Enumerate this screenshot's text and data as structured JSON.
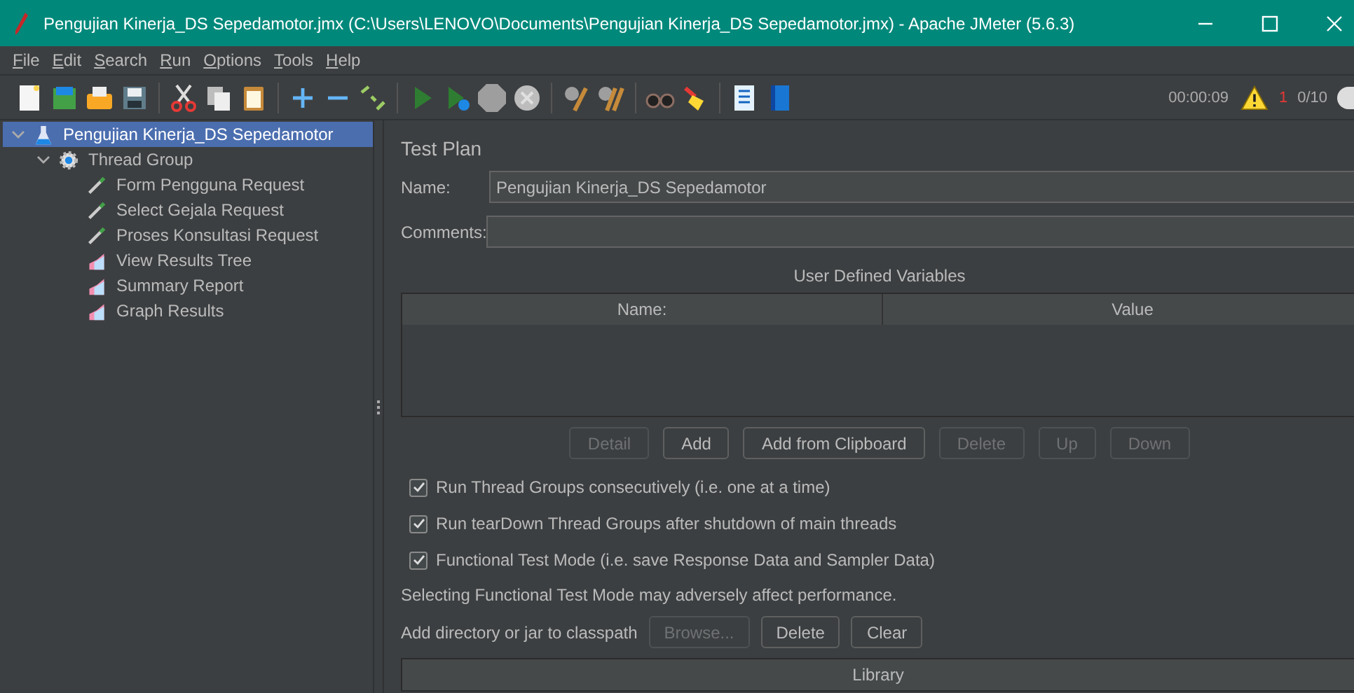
{
  "window": {
    "title": "Pengujian Kinerja_DS Sepedamotor.jmx (C:\\Users\\LENOVO\\Documents\\Pengujian Kinerja_DS Sepedamotor.jmx) - Apache JMeter (5.6.3)"
  },
  "menu": [
    "File",
    "Edit",
    "Search",
    "Run",
    "Options",
    "Tools",
    "Help"
  ],
  "status": {
    "timer": "00:00:09",
    "warnings": "1",
    "threads": "0/10"
  },
  "tree": [
    {
      "label": "Pengujian Kinerja_DS Sepedamotor",
      "kind": "test-plan",
      "selected": true,
      "expanded": true,
      "children": [
        {
          "label": "Thread Group",
          "kind": "thread-group",
          "selected": false,
          "expanded": true,
          "children": [
            {
              "label": "Form Pengguna Request",
              "kind": "sampler",
              "selected": false
            },
            {
              "label": "Select Gejala Request",
              "kind": "sampler",
              "selected": false
            },
            {
              "label": "Proses Konsultasi Request",
              "kind": "sampler",
              "selected": false
            },
            {
              "label": "View Results Tree",
              "kind": "listener",
              "selected": false
            },
            {
              "label": "Summary Report",
              "kind": "listener",
              "selected": false
            },
            {
              "label": "Graph Results",
              "kind": "listener",
              "selected": false
            }
          ]
        }
      ]
    }
  ],
  "panel": {
    "title": "Test Plan",
    "name_label": "Name:",
    "name_value": "Pengujian Kinerja_DS Sepedamotor",
    "comments_label": "Comments:",
    "variables": {
      "title": "User Defined Variables",
      "columns": [
        "Name:",
        "Value"
      ]
    },
    "buttons": [
      {
        "label": "Detail",
        "disabled": true
      },
      {
        "label": "Add",
        "disabled": false
      },
      {
        "label": "Add from Clipboard",
        "disabled": false
      },
      {
        "label": "Delete",
        "disabled": true
      },
      {
        "label": "Up",
        "disabled": true
      },
      {
        "label": "Down",
        "disabled": true
      }
    ],
    "options": [
      {
        "label": "Run Thread Groups consecutively (i.e. one at a time)",
        "checked": true
      },
      {
        "label": "Run tearDown Thread Groups after shutdown of main threads",
        "checked": true
      },
      {
        "label": "Functional Test Mode (i.e. save Response Data and Sampler Data)",
        "checked": true
      }
    ],
    "note": "Selecting Functional Test Mode may adversely affect performance.",
    "classpath": {
      "label": "Add directory or jar to classpath",
      "buttons": [
        {
          "label": "Browse...",
          "disabled": true
        },
        {
          "label": "Delete",
          "disabled": false
        },
        {
          "label": "Clear",
          "disabled": false
        }
      ]
    },
    "library": {
      "columns": [
        "Library"
      ]
    }
  }
}
